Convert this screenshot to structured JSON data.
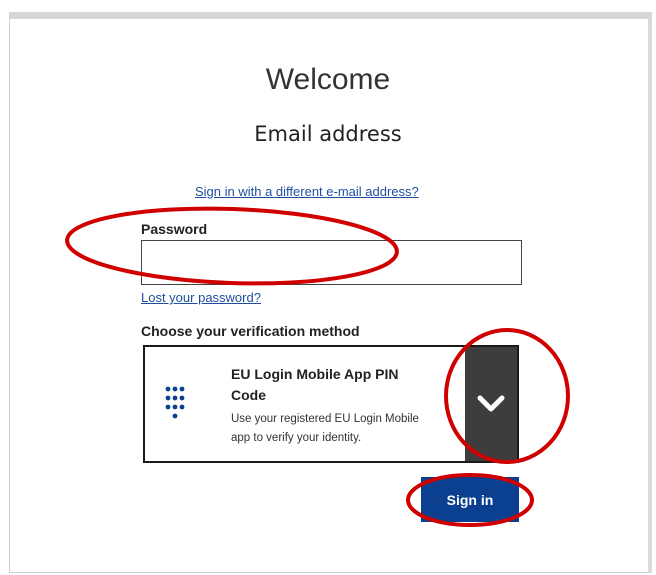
{
  "header": {
    "title": "Welcome",
    "email": "Email address"
  },
  "links": {
    "different_email": "Sign in with a different e-mail address?",
    "lost_password": "Lost your password?"
  },
  "password": {
    "label": "Password",
    "value": ""
  },
  "verification": {
    "label": "Choose your verification method",
    "method": {
      "title_line1": "EU Login Mobile App PIN",
      "title_line2": "Code",
      "desc_line1": "Use your registered EU Login Mobile",
      "desc_line2": "app to verify your identity.",
      "icon": "keypad-icon"
    }
  },
  "actions": {
    "sign_in": "Sign in"
  },
  "colors": {
    "link": "#1f4e9e",
    "primary": "#0b3f8f",
    "highlight": "#d00000",
    "dropdown": "#3d3d3d"
  }
}
